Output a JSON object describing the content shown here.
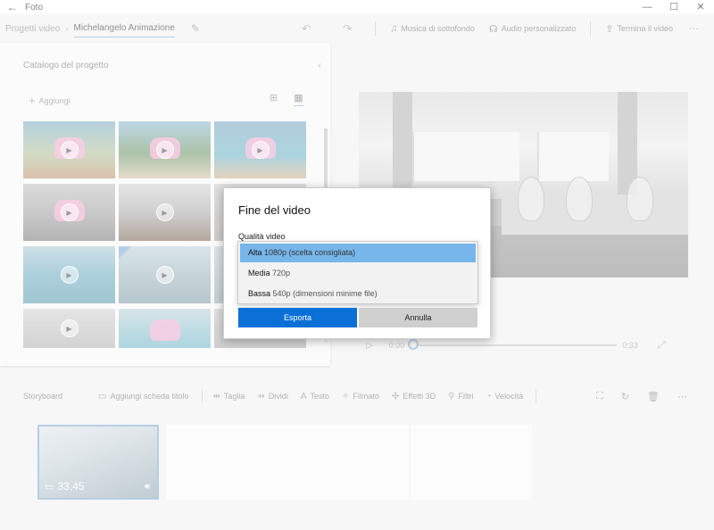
{
  "window": {
    "title": "Foto",
    "back_icon": "←",
    "controls": [
      "—",
      "☐",
      "✕"
    ]
  },
  "toolbar": {
    "breadcrumb_root": "Progetti video",
    "project_name": "Michelangelo Animazione",
    "background_music": "Musica di sottofondo",
    "custom_audio": "Audio personalizzato",
    "finish_video": "Termina il video"
  },
  "catalog": {
    "title": "Catalogo del progetto",
    "add_label": "Aggiungi"
  },
  "player": {
    "current_time": "0:00",
    "total_time": "0:33",
    "progress": 0
  },
  "storyboard": {
    "title": "Storyboard",
    "actions": [
      {
        "icon": "title-card-icon",
        "glyph": "▭",
        "label": "Aggiungi scheda titolo"
      },
      {
        "icon": "trim-icon",
        "glyph": "⇹",
        "label": "Taglia"
      },
      {
        "icon": "split-icon",
        "glyph": "⇸",
        "label": "Dividi"
      },
      {
        "icon": "text-icon",
        "glyph": "A",
        "label": "Testo"
      },
      {
        "icon": "motion-icon",
        "glyph": "✧",
        "label": "Filmato"
      },
      {
        "icon": "3d-effects-icon",
        "glyph": "✣",
        "label": "Effetti 3D"
      },
      {
        "icon": "filters-icon",
        "glyph": "⚲",
        "label": "Filtri"
      },
      {
        "icon": "speed-icon",
        "glyph": "◔",
        "label": "Velocità"
      }
    ],
    "clip_duration": "33,45"
  },
  "dialog": {
    "title": "Fine del video",
    "quality_label": "Qualità video",
    "options": [
      {
        "name": "Alta",
        "detail": "1080p (scelta consigliata)",
        "selected": true
      },
      {
        "name": "Media",
        "detail": "720p",
        "selected": false
      },
      {
        "name": "Bassa",
        "detail": "540p (dimensioni minime file)",
        "selected": false
      }
    ],
    "export_button": "Esporta",
    "cancel_button": "Annulla"
  },
  "colors": {
    "accent": "#0a6fd6",
    "selection": "#77b6ea",
    "highlight": "#8fb5d9"
  }
}
